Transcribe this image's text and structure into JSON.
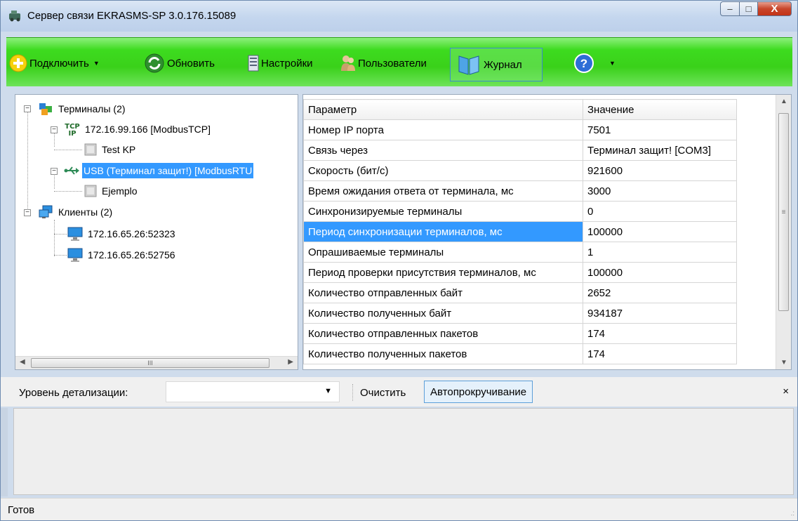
{
  "window": {
    "title": "Сервер связи EKRASMS-SP 3.0.176.15089",
    "minimize": "–",
    "maximize": "□",
    "close": "X"
  },
  "toolbar": {
    "connect": "Подключить",
    "refresh": "Обновить",
    "settings": "Настройки",
    "users": "Пользователи",
    "journal": "Журнал",
    "help_icon": "question-icon"
  },
  "tree": {
    "terminals": "Терминалы (2)",
    "tcp_node": "172.16.99.166 [ModbusTCP]",
    "tcp_child": "Test KP",
    "usb_node": "USB (Терминал защит!) [ModbusRTU",
    "usb_child": "Ejemplo",
    "clients": "Клиенты (2)",
    "client1": "172.16.65.26:52323",
    "client2": "172.16.65.26:52756",
    "hscroll_thumb": "III"
  },
  "grid": {
    "headers": [
      "Параметр",
      "Значение"
    ],
    "rows": [
      [
        "Номер IP порта",
        "7501"
      ],
      [
        "Связь через",
        "Терминал защит! [COM3]"
      ],
      [
        "Скорость (бит/с)",
        "921600"
      ],
      [
        "Время ожидания ответа от терминала, мс",
        "3000"
      ],
      [
        "Синхронизируемые терминалы",
        "0"
      ],
      [
        "Период синхронизации терминалов, мс",
        "100000"
      ],
      [
        "Опрашиваемые терминалы",
        "1"
      ],
      [
        "Период проверки присутствия терминалов, мс",
        "100000"
      ],
      [
        "Количество отправленных байт",
        "2652"
      ],
      [
        "Количество полученных байт",
        "934187"
      ],
      [
        "Количество отправленных пакетов",
        "174"
      ],
      [
        "Количество полученных пакетов",
        "174"
      ]
    ],
    "selected_row": 5
  },
  "log": {
    "detail_label": "Уровень детализации:",
    "detail_value": "",
    "clear": "Очистить",
    "autoscroll": "Автопрокручивание",
    "close": "×"
  },
  "status": {
    "text": "Готов"
  },
  "colors": {
    "toolbar_green": "#3ddb1f",
    "selection": "#3399ff"
  }
}
